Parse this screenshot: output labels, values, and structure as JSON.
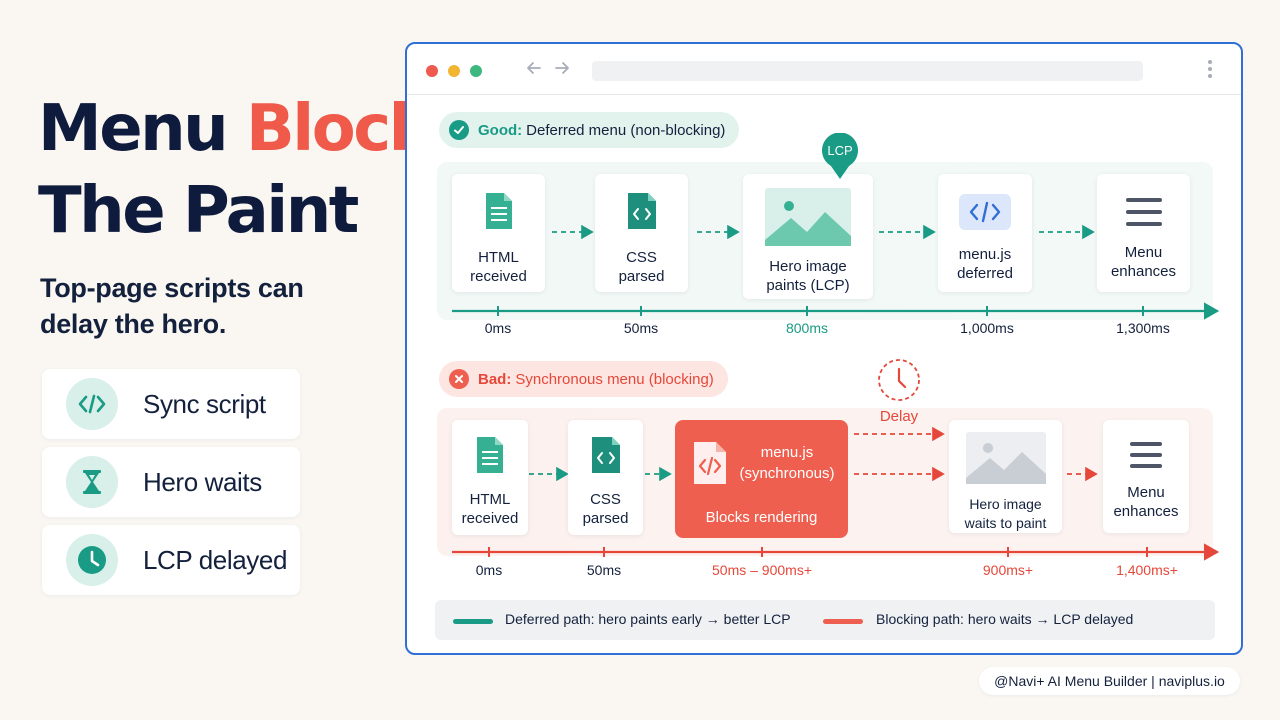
{
  "headline": {
    "word1": "Menu",
    "word2": "Blocks",
    "line2": "The Paint"
  },
  "subhead": "Top-page scripts can delay the hero.",
  "features": [
    {
      "icon": "code-icon",
      "label": "Sync script"
    },
    {
      "icon": "hourglass-icon",
      "label": "Hero waits"
    },
    {
      "icon": "clock-icon",
      "label": "LCP delayed"
    }
  ],
  "colors": {
    "teal": "#1a9b85",
    "red": "#ef5f4f",
    "navy": "#0f1b3d",
    "browser_border": "#2f6fd6"
  },
  "good": {
    "label_strong": "Good:",
    "label_rest": "Deferred menu (non-blocking)",
    "lcp_badge": "LCP",
    "steps": [
      {
        "icon": "document-icon",
        "line1": "HTML",
        "line2": "received",
        "time": "0ms"
      },
      {
        "icon": "css-file-icon",
        "line1": "CSS",
        "line2": "parsed",
        "time": "50ms"
      },
      {
        "icon": "image-icon",
        "line1": "Hero image",
        "line2": "paints (LCP)",
        "time": "800ms"
      },
      {
        "icon": "code-icon",
        "line1": "menu.js",
        "line2": "deferred",
        "time": "1,000ms"
      },
      {
        "icon": "menu-icon",
        "line1": "Menu",
        "line2": "enhances",
        "time": "1,300ms"
      }
    ]
  },
  "bad": {
    "label_strong": "Bad:",
    "label_rest": "Synchronous menu (blocking)",
    "delay_label": "Delay",
    "blocker": {
      "line1": "menu.js",
      "line2": "(synchronous)",
      "footer": "Blocks rendering"
    },
    "steps": [
      {
        "icon": "document-icon",
        "line1": "HTML",
        "line2": "received",
        "time": "0ms"
      },
      {
        "icon": "css-file-icon",
        "line1": "CSS",
        "line2": "parsed",
        "time": "50ms"
      },
      {
        "icon": "code-file-icon",
        "time": "50ms – 900ms+"
      },
      {
        "icon": "image-icon",
        "line1": "Hero image",
        "line2": "waits to paint",
        "time": "900ms+"
      },
      {
        "icon": "menu-icon",
        "line1": "Menu",
        "line2": "enhances",
        "time": "1,400ms+"
      }
    ]
  },
  "legend": {
    "deferred": "Deferred path: hero paints early → better LCP",
    "blocking": "Blocking path: hero waits → LCP delayed"
  },
  "credit": "@Navi+ AI Menu Builder | naviplus.io"
}
